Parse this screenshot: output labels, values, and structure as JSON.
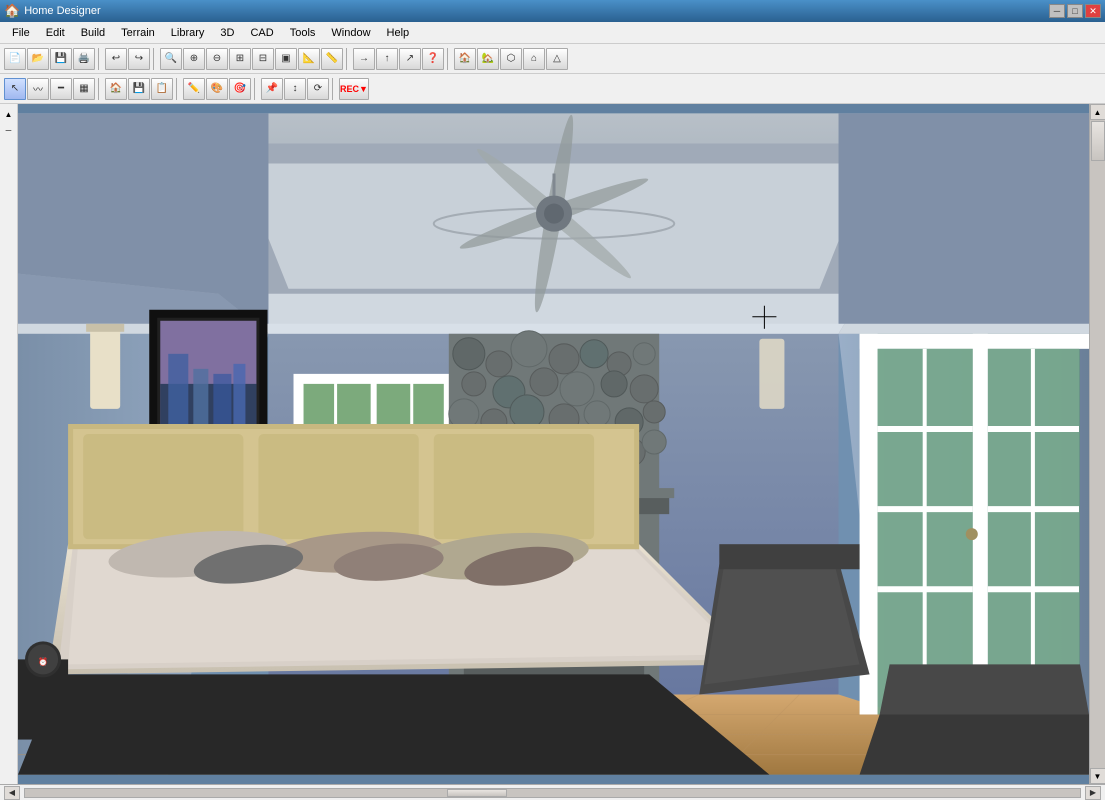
{
  "app": {
    "title": "Home Designer",
    "icon": "🏠"
  },
  "titlebar": {
    "title": "Home Designer",
    "minimize": "─",
    "maximize": "□",
    "close": "✕"
  },
  "menu": {
    "items": [
      "File",
      "Edit",
      "Build",
      "Terrain",
      "Library",
      "3D",
      "CAD",
      "Tools",
      "Window",
      "Help"
    ]
  },
  "toolbar1": {
    "buttons": [
      "📄",
      "📁",
      "💾",
      "🖨️",
      "|",
      "↩",
      "↪",
      "|",
      "🔍",
      "🔍+",
      "🔍-",
      "⊞",
      "⊟",
      "⬛",
      "📐",
      "📐",
      "|",
      "→",
      "↑",
      "↗",
      "❓",
      "|",
      "🏠",
      "🏡",
      "⬡",
      "🏠"
    ]
  },
  "toolbar2": {
    "buttons": [
      "↖",
      "〰",
      "━",
      "▦",
      "🏠",
      "💾",
      "📋",
      "✏️",
      "🎨",
      "🔧",
      "📌",
      "↕",
      "⟳",
      "⏺"
    ]
  },
  "statusbar": {
    "text": ""
  }
}
